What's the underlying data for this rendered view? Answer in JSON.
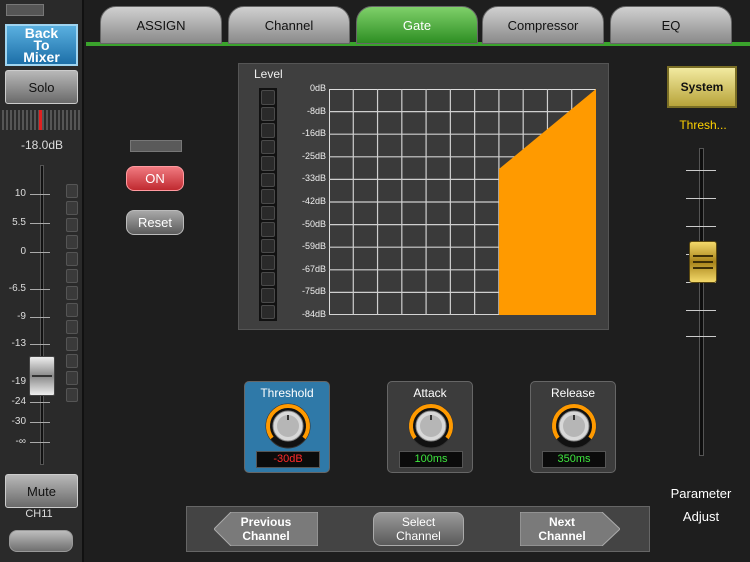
{
  "channel_strip": {
    "back_label": "Back\nTo\nMixer",
    "solo_label": "Solo",
    "fader_value": "-18.0dB",
    "scale": [
      "10",
      "5.5",
      "0",
      "-6.5",
      "-9",
      "-13",
      "-19",
      "-24",
      "-30",
      "-∞"
    ],
    "mute_label": "Mute",
    "channel_name": "CH11",
    "pan_level": 0.5,
    "fader_level": 0.68
  },
  "tabs": [
    {
      "label": "ASSIGN",
      "active": false
    },
    {
      "label": "Channel",
      "active": false
    },
    {
      "label": "Gate",
      "active": true
    },
    {
      "label": "Compressor",
      "active": false
    },
    {
      "label": "EQ",
      "active": false
    }
  ],
  "gate": {
    "on_label": "ON",
    "reset_label": "Reset",
    "level_label": "Level",
    "y_ticks": [
      "0dB",
      "-8dB",
      "-16dB",
      "-25dB",
      "-33dB",
      "-42dB",
      "-50dB",
      "-59dB",
      "-67dB",
      "-75dB",
      "-84dB"
    ]
  },
  "knobs": [
    {
      "title": "Threshold",
      "value": "-30dB",
      "value_color": "#ff2a2a",
      "selected": true
    },
    {
      "title": "Attack",
      "value": "100ms",
      "value_color": "#3ee63e",
      "selected": false
    },
    {
      "title": "Release",
      "value": "350ms",
      "value_color": "#3ee63e",
      "selected": false
    }
  ],
  "nav": {
    "previous_label": "Previous\nChannel",
    "select_label": "Select\nChannel",
    "next_label": "Next\nChannel"
  },
  "right_panel": {
    "system_label": "System",
    "parameter_name": "Thresh...",
    "parameter_label": "Parameter\nAdjust",
    "parameter_level": 0.69
  },
  "colors": {
    "gate_curve": "#ff9a00",
    "tab_active": "#3aa32c",
    "on_button": "#d83a40",
    "threshold_panel": "#2f79a8"
  }
}
